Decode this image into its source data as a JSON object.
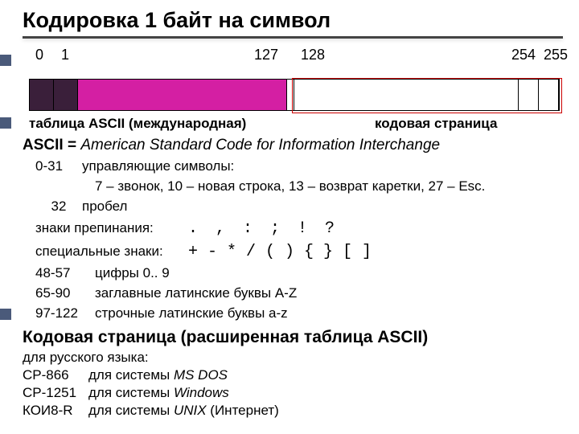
{
  "title": "Кодировка 1 байт на символ",
  "byte_diagram": {
    "labels": {
      "n0": "0",
      "n1": "1",
      "n127": "127",
      "n128": "128",
      "n254": "254",
      "n255": "255"
    },
    "caption_left": "таблица ASCII (международная)",
    "caption_right": "кодовая страница"
  },
  "ascii_def": {
    "prefix": "ASCII = ",
    "expansion": "American Standard Code for Information Interchange"
  },
  "control": {
    "range": "0-31",
    "label": "управляющие символы:",
    "examples": "7 – звонок, 10 – новая строка, 13 – возврат каретки, 27 – Esc."
  },
  "space": {
    "code": "32",
    "label": "пробел"
  },
  "punct": {
    "label": "знаки препинания:",
    "chars": ".  ,  :  ;  !  ?"
  },
  "special": {
    "label": "специальные знаки:",
    "chars": "+  -  *  /   ( )   { }   [ ]"
  },
  "ranges": {
    "digits": {
      "r": "48-57",
      "t": "цифры 0.. 9"
    },
    "upper": {
      "r": "65-90",
      "t": "заглавные латинские буквы A-Z"
    },
    "lower": {
      "r": "97-122",
      "t": "строчные латинские буквы a-z"
    }
  },
  "codepage": {
    "heading": "Кодовая страница (расширенная таблица ASCII)",
    "intro": "для русского языка:",
    "items": [
      {
        "name": "CP-866",
        "desc_prefix": "для системы ",
        "desc_em": "MS DOS",
        "desc_suffix": ""
      },
      {
        "name": "CP-1251",
        "desc_prefix": "для системы ",
        "desc_em": "Windows",
        "desc_suffix": ""
      },
      {
        "name": "КОИ8-R",
        "desc_prefix": "для системы ",
        "desc_em": "UNIX",
        "desc_suffix": " (Интернет)"
      }
    ]
  }
}
